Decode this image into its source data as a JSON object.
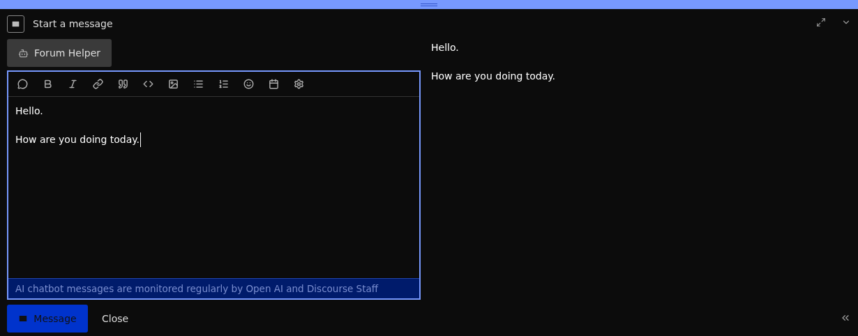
{
  "header": {
    "title": "Start a message"
  },
  "recipient": {
    "label": "Forum Helper"
  },
  "toolbar": [
    {
      "kind": "chat"
    },
    {
      "kind": "bold"
    },
    {
      "kind": "italic"
    },
    {
      "kind": "link"
    },
    {
      "kind": "quote"
    },
    {
      "kind": "code"
    },
    {
      "kind": "image"
    },
    {
      "kind": "bullets"
    },
    {
      "kind": "numbers"
    },
    {
      "kind": "emoji"
    },
    {
      "kind": "calendar"
    },
    {
      "kind": "settings"
    }
  ],
  "editor": {
    "paragraphs": [
      "Hello.",
      "How are you doing today."
    ]
  },
  "notice": "AI chatbot messages are monitored regularly by Open AI and Discourse Staff",
  "preview": {
    "paragraphs": [
      "Hello.",
      "How are you doing today."
    ]
  },
  "actions": {
    "primary": "Message",
    "secondary": "Close"
  }
}
